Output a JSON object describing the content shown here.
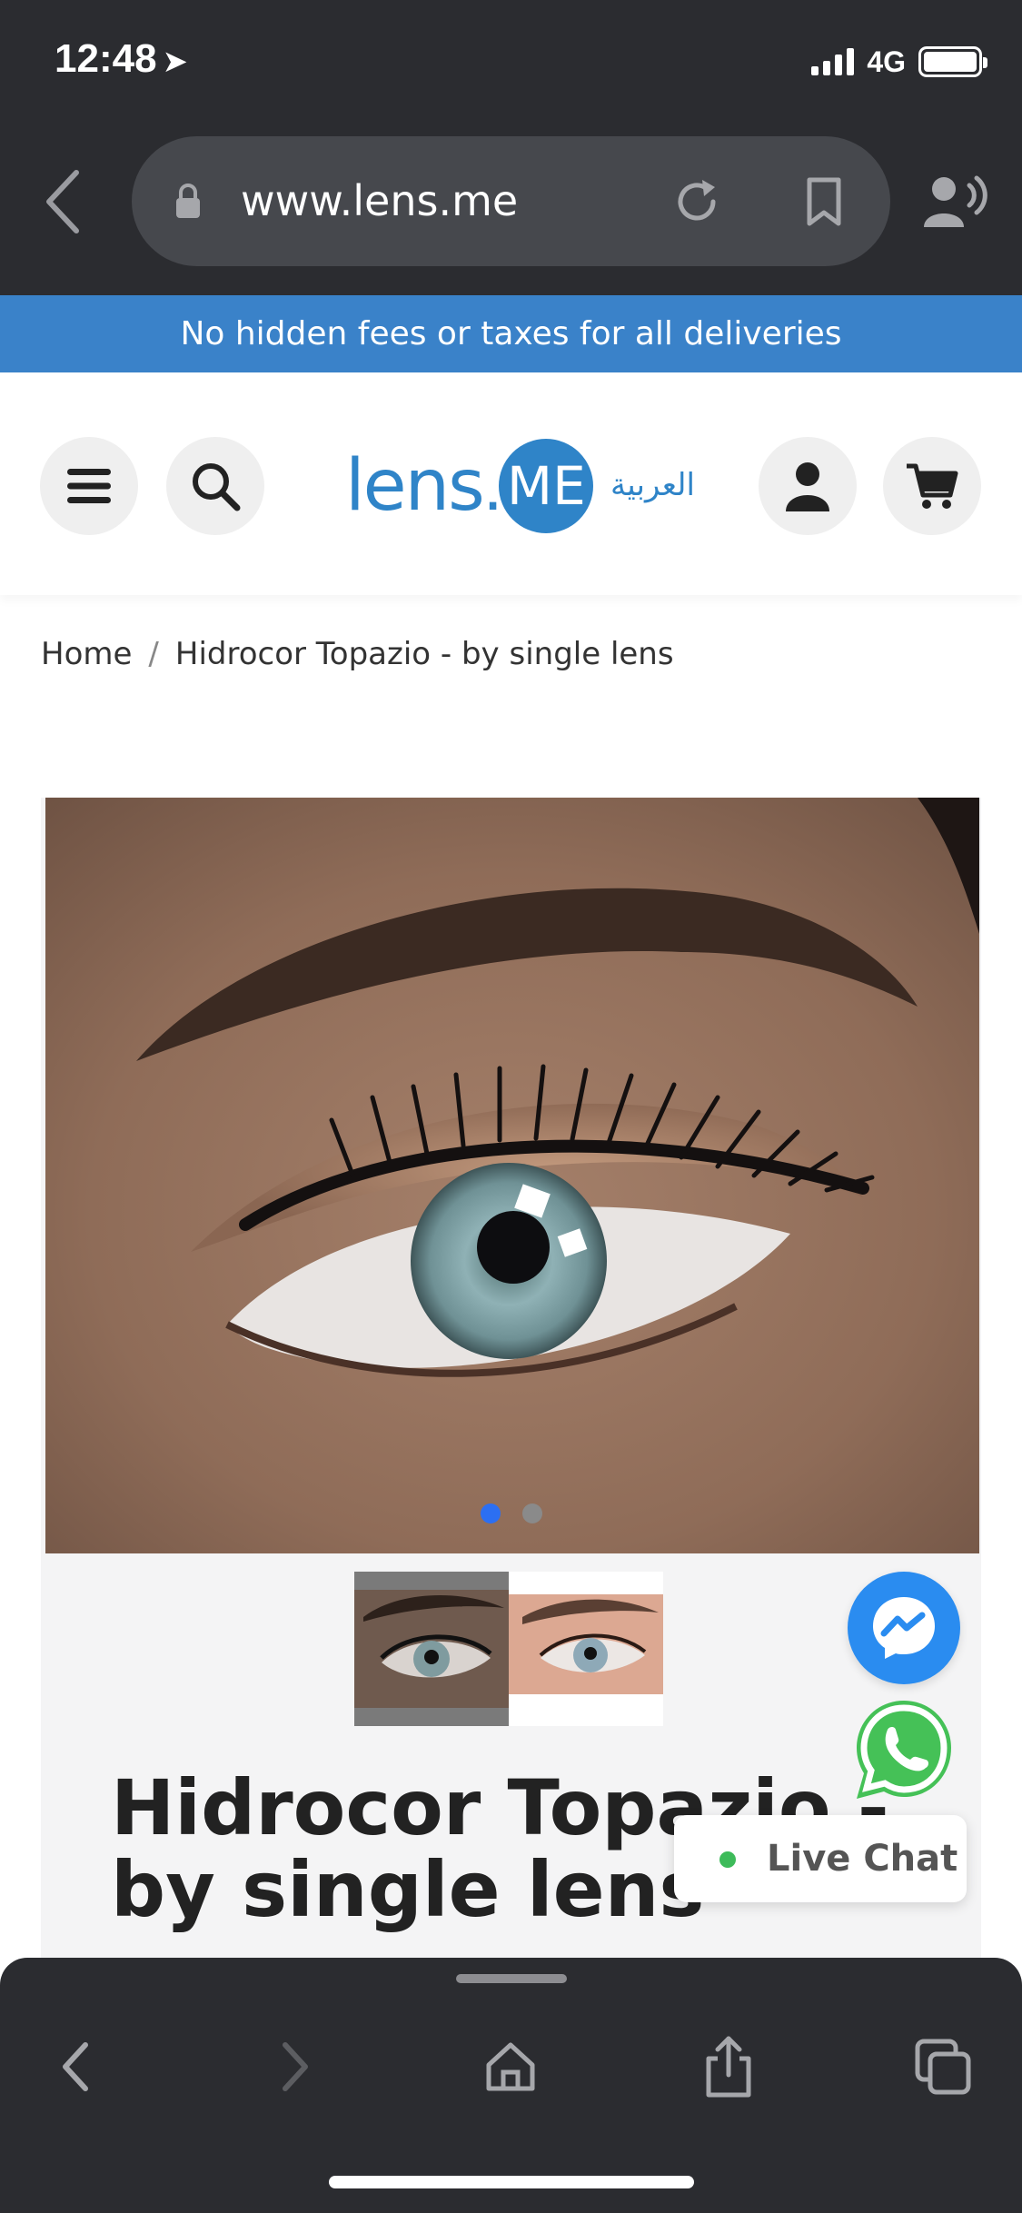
{
  "status_bar": {
    "time": "12:48",
    "network": "4G"
  },
  "browser": {
    "url": "www.lens.me"
  },
  "promo": {
    "text": "No hidden fees or taxes for all deliveries"
  },
  "header": {
    "logo_text": "lens",
    "logo_dot": ".",
    "logo_badge": "ME",
    "language_link": "العربية"
  },
  "breadcrumb": {
    "home": "Home",
    "separator": "/",
    "current": "Hidrocor Topazio - by single lens"
  },
  "product": {
    "title": "Hidrocor Topazio - by single lens",
    "gallery": {
      "slide_count": 2,
      "active_slide": 1,
      "thumbnail_count": 2
    }
  },
  "chat": {
    "live_chat_label": "Live Chat"
  },
  "colors": {
    "brand_blue": "#2f84c8",
    "promo_blue": "#3a82c9",
    "browser_chrome": "#2b2c30",
    "messenger_blue": "#2a8cf0",
    "whatsapp_green": "#45c157",
    "online_green": "#3dbb5a"
  },
  "icons": {
    "menu": "hamburger-menu-icon",
    "search": "search-icon",
    "account": "user-icon",
    "cart": "cart-icon",
    "messenger": "messenger-icon",
    "whatsapp": "whatsapp-icon"
  }
}
